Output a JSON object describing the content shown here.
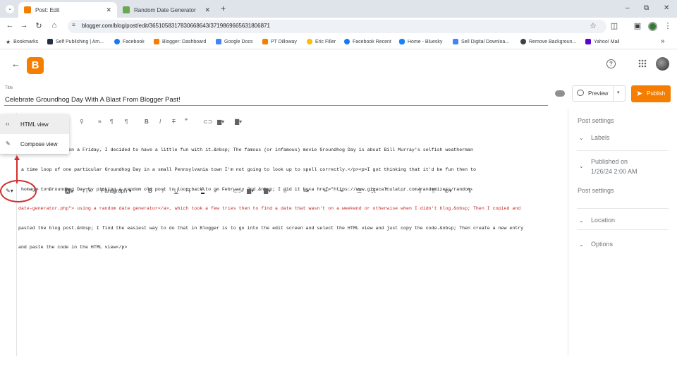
{
  "browser": {
    "tabs": [
      {
        "title": "Post: Edit",
        "active": true,
        "favicon_color": "#f57d00"
      },
      {
        "title": "Random Date Generator",
        "active": false,
        "favicon_color": "#6aa84f"
      }
    ],
    "new_tab_label": "+",
    "url": "blogger.com/blog/post/edit/3651058317830668643/3719869665631806871",
    "window_controls": {
      "minimize": "–",
      "restore": "⧉",
      "close": "✕"
    }
  },
  "bookmarks": [
    {
      "label": "Bookmarks",
      "color": "#5f6368"
    },
    {
      "label": "Self Publishing | Am...",
      "color": "#232f3e"
    },
    {
      "label": "Facebook",
      "color": "#1877f2"
    },
    {
      "label": "Blogger: Dashboard",
      "color": "#f57d00"
    },
    {
      "label": "Google Docs",
      "color": "#4285f4"
    },
    {
      "label": "PT Dilloway",
      "color": "#f57d00"
    },
    {
      "label": "Eric Filler",
      "color": "#fbbc04"
    },
    {
      "label": "Facebook Recent",
      "color": "#1877f2"
    },
    {
      "label": "Home - Bluesky",
      "color": "#1185fe"
    },
    {
      "label": "Sell Digital Downloa...",
      "color": "#4285f4"
    },
    {
      "label": "Remove Backgroun...",
      "color": "#3c4043"
    },
    {
      "label": "Yahoo! Mail",
      "color": "#6001d2"
    }
  ],
  "bookmarks_more": "»",
  "app": {
    "logo_letter": "B",
    "help_icon": "?",
    "apps_icon": "⋮⋮⋮"
  },
  "post": {
    "title_label": "Title",
    "title": "Celebrate Groundhog Day With A Blast From Blogger Past!",
    "preview_label": "Preview",
    "publish_label": "Publish"
  },
  "view_menu": {
    "html_view": "HTML view",
    "compose_view": "Compose view"
  },
  "html_toolbar": {
    "paragraph_label": "Paragraph"
  },
  "code_lines": [
    {
      "text": "oundhog Day falls on a Friday, I decided to have a little fun with it.&nbsp; The famous (or infamous) movie Groundhog Day is about Bill Murray's selfish weatherman",
      "red": false
    },
    {
      "text": " a time loop of one particular Groundhog Day in a small Pennsylvania town I'm not going to look up to spell correctly.</p><p>I got thinking that it'd be fun then to",
      "red": false
    },
    {
      "text": " homage to Groundhog Day by picking a random old post to loop back to on February 2nd.&nbsp; I did it by<a href=\"https://www.gigacalculator.com/randomizers/random-",
      "red": false
    },
    {
      "text": "date-generator.php\"> using a random date generator</a>, which took a few tries then to find a date that wasn't on a weekend or otherwise when I didn't blog.&nbsp; Then I copied and",
      "red": true
    },
    {
      "text": "pasted the blog post.&nbsp; I find the easiest way to do that in Blogger is to go into the edit screen and select the HTML view and just copy the code.&nbsp; Then create a new entry",
      "red": false
    },
    {
      "text": "and paste the code in the HTML view</p>",
      "red": false
    }
  ],
  "settings": {
    "post_settings": "Post settings",
    "labels": "Labels",
    "published_on": "Published on",
    "published_date": "1/26/24 2:00 AM",
    "post_settings_2": "Post settings",
    "location": "Location",
    "options": "Options"
  },
  "colors": {
    "accent": "#f57d00",
    "annotation": "#d32f2f"
  }
}
